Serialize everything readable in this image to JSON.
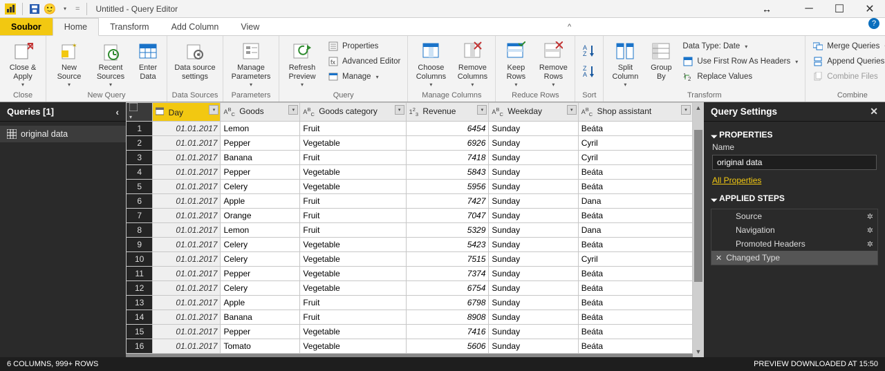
{
  "titlebar": {
    "app_icon": "bar-chart-icon",
    "title": "Untitled - Query Editor"
  },
  "menu": {
    "file": "Soubor",
    "tabs": [
      "Home",
      "Transform",
      "Add Column",
      "View"
    ],
    "active": "Home"
  },
  "ribbon": {
    "close": {
      "close_apply": "Close &\nApply",
      "group": "Close"
    },
    "newquery": {
      "new_source": "New\nSource",
      "recent_sources": "Recent\nSources",
      "enter_data": "Enter\nData",
      "group": "New Query"
    },
    "datasources": {
      "settings": "Data source\nsettings",
      "group": "Data Sources"
    },
    "parameters": {
      "manage": "Manage\nParameters",
      "group": "Parameters"
    },
    "query": {
      "refresh": "Refresh\nPreview",
      "properties": "Properties",
      "adv": "Advanced Editor",
      "manage": "Manage",
      "group": "Query"
    },
    "managecols": {
      "choose": "Choose\nColumns",
      "remove": "Remove\nColumns",
      "group": "Manage Columns"
    },
    "reducerows": {
      "keep": "Keep\nRows",
      "remove": "Remove\nRows",
      "group": "Reduce Rows"
    },
    "sort": {
      "group": "Sort"
    },
    "transform": {
      "split": "Split\nColumn",
      "group_by": "Group\nBy",
      "datatype": "Data Type: Date",
      "first_row": "Use First Row As Headers",
      "replace": "Replace Values",
      "group": "Transform"
    },
    "combine": {
      "merge": "Merge Queries",
      "append": "Append Queries",
      "files": "Combine Files",
      "group": "Combine"
    }
  },
  "queries": {
    "title": "Queries [1]",
    "items": [
      {
        "label": "original data"
      }
    ]
  },
  "grid": {
    "columns": [
      {
        "name": "Day",
        "type": "date",
        "selected": true
      },
      {
        "name": "Goods",
        "type": "abc"
      },
      {
        "name": "Goods category",
        "type": "abc"
      },
      {
        "name": "Revenue",
        "type": "123"
      },
      {
        "name": "Weekday",
        "type": "abc"
      },
      {
        "name": "Shop assistant",
        "type": "abc"
      }
    ],
    "rows": [
      {
        "n": 1,
        "day": "01.01.2017",
        "goods": "Lemon",
        "cat": "Fruit",
        "rev": "6454",
        "wd": "Sunday",
        "sa": "Beáta"
      },
      {
        "n": 2,
        "day": "01.01.2017",
        "goods": "Pepper",
        "cat": "Vegetable",
        "rev": "6926",
        "wd": "Sunday",
        "sa": "Cyril"
      },
      {
        "n": 3,
        "day": "01.01.2017",
        "goods": "Banana",
        "cat": "Fruit",
        "rev": "7418",
        "wd": "Sunday",
        "sa": "Cyril"
      },
      {
        "n": 4,
        "day": "01.01.2017",
        "goods": "Pepper",
        "cat": "Vegetable",
        "rev": "5843",
        "wd": "Sunday",
        "sa": "Beáta"
      },
      {
        "n": 5,
        "day": "01.01.2017",
        "goods": "Celery",
        "cat": "Vegetable",
        "rev": "5956",
        "wd": "Sunday",
        "sa": "Beáta"
      },
      {
        "n": 6,
        "day": "01.01.2017",
        "goods": "Apple",
        "cat": "Fruit",
        "rev": "7427",
        "wd": "Sunday",
        "sa": "Dana"
      },
      {
        "n": 7,
        "day": "01.01.2017",
        "goods": "Orange",
        "cat": "Fruit",
        "rev": "7047",
        "wd": "Sunday",
        "sa": "Beáta"
      },
      {
        "n": 8,
        "day": "01.01.2017",
        "goods": "Lemon",
        "cat": "Fruit",
        "rev": "5329",
        "wd": "Sunday",
        "sa": "Dana"
      },
      {
        "n": 9,
        "day": "01.01.2017",
        "goods": "Celery",
        "cat": "Vegetable",
        "rev": "5423",
        "wd": "Sunday",
        "sa": "Beáta"
      },
      {
        "n": 10,
        "day": "01.01.2017",
        "goods": "Celery",
        "cat": "Vegetable",
        "rev": "7515",
        "wd": "Sunday",
        "sa": "Cyril"
      },
      {
        "n": 11,
        "day": "01.01.2017",
        "goods": "Pepper",
        "cat": "Vegetable",
        "rev": "7374",
        "wd": "Sunday",
        "sa": "Beáta"
      },
      {
        "n": 12,
        "day": "01.01.2017",
        "goods": "Celery",
        "cat": "Vegetable",
        "rev": "6754",
        "wd": "Sunday",
        "sa": "Beáta"
      },
      {
        "n": 13,
        "day": "01.01.2017",
        "goods": "Apple",
        "cat": "Fruit",
        "rev": "6798",
        "wd": "Sunday",
        "sa": "Beáta"
      },
      {
        "n": 14,
        "day": "01.01.2017",
        "goods": "Banana",
        "cat": "Fruit",
        "rev": "8908",
        "wd": "Sunday",
        "sa": "Beáta"
      },
      {
        "n": 15,
        "day": "01.01.2017",
        "goods": "Pepper",
        "cat": "Vegetable",
        "rev": "7416",
        "wd": "Sunday",
        "sa": "Beáta"
      },
      {
        "n": 16,
        "day": "01.01.2017",
        "goods": "Tomato",
        "cat": "Vegetable",
        "rev": "5606",
        "wd": "Sunday",
        "sa": "Beáta"
      }
    ]
  },
  "settings": {
    "title": "Query Settings",
    "properties_section": "PROPERTIES",
    "name_label": "Name",
    "name_value": "original data",
    "all_props": "All Properties",
    "applied_section": "APPLIED STEPS",
    "steps": [
      {
        "label": "Source",
        "gear": true
      },
      {
        "label": "Navigation",
        "gear": true
      },
      {
        "label": "Promoted Headers",
        "gear": true
      },
      {
        "label": "Changed Type",
        "gear": false,
        "selected": true
      }
    ]
  },
  "statusbar": {
    "left": "6 COLUMNS, 999+ ROWS",
    "right": "PREVIEW DOWNLOADED AT 15:50"
  }
}
